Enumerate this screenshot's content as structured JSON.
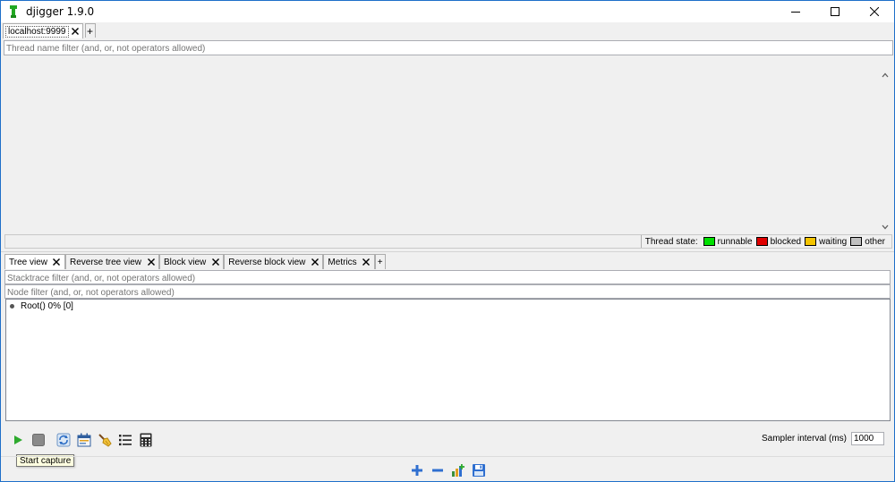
{
  "window": {
    "title": "djigger 1.9.0",
    "icons": {
      "app": "djigger-app-icon",
      "minimize": "minimize-icon",
      "maximize": "maximize-icon",
      "close": "close-icon"
    }
  },
  "connection_tabs": [
    {
      "label": "localhost:9999",
      "active": true
    }
  ],
  "add_tab_label": "+",
  "thread_filter": {
    "placeholder": "Thread name filter (and, or, not operators allowed)",
    "value": ""
  },
  "legend": {
    "title": "Thread state:",
    "items": [
      {
        "label": "runnable",
        "color": "#00e000"
      },
      {
        "label": "blocked",
        "color": "#e00000"
      },
      {
        "label": "waiting",
        "color": "#f5c400"
      },
      {
        "label": "other",
        "color": "#c0c0c0"
      }
    ]
  },
  "view_tabs": [
    {
      "label": "Tree view",
      "active": true
    },
    {
      "label": "Reverse tree view",
      "active": false
    },
    {
      "label": "Block view",
      "active": false
    },
    {
      "label": "Reverse block view",
      "active": false
    },
    {
      "label": "Metrics",
      "active": false
    }
  ],
  "stacktrace_filter": {
    "placeholder": "Stacktrace filter (and, or, not operators allowed)",
    "value": ""
  },
  "node_filter": {
    "placeholder": "Node filter (and, or, not operators allowed)",
    "value": ""
  },
  "tree": {
    "root_label": "Root()  0% [0]"
  },
  "toolbar": {
    "icons": [
      "play-icon",
      "stop-icon",
      "refresh-icon",
      "save-capture-icon",
      "clear-brush-icon",
      "list-icon",
      "calculator-icon"
    ],
    "tooltip": "Start capture"
  },
  "sampler": {
    "label": "Sampler interval (ms)",
    "value": "1000"
  },
  "bottom_tools": {
    "icons": [
      "expand-plus-icon",
      "collapse-minus-icon",
      "add-chart-icon",
      "save-file-icon"
    ]
  }
}
